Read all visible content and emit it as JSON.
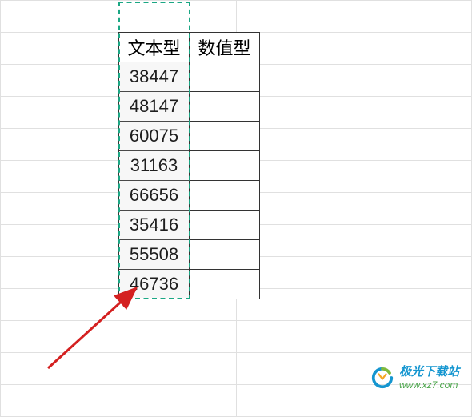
{
  "headers": {
    "col1": "文本型",
    "col2": "数值型"
  },
  "values": [
    "38447",
    "48147",
    "60075",
    "31163",
    "66656",
    "35416",
    "55508",
    "46736"
  ],
  "watermark": {
    "title": "极光下载站",
    "url": "www.xz7.com"
  },
  "chart_data": {
    "type": "table",
    "columns": [
      "文本型",
      "数值型"
    ],
    "rows": [
      [
        "38447",
        ""
      ],
      [
        "48147",
        ""
      ],
      [
        "60075",
        ""
      ],
      [
        "31163",
        ""
      ],
      [
        "66656",
        ""
      ],
      [
        "35416",
        ""
      ],
      [
        "55508",
        ""
      ],
      [
        "46736",
        ""
      ]
    ]
  }
}
